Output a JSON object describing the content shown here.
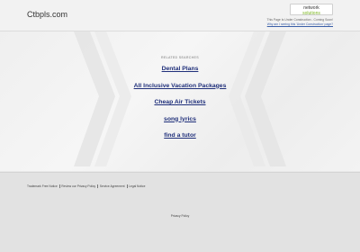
{
  "header": {
    "domain": "Ctbpls.com",
    "logo_line1": "network",
    "logo_line2": "solutions",
    "notice_line": "This Page Is Under Construction - Coming Soon!",
    "notice_link": "Why am I seeing this 'Under Construction' page?"
  },
  "main": {
    "related_label": "RELATED SEARCHES",
    "searches": [
      "Dental Plans",
      "All Inclusive Vacation Packages",
      "Cheap Air Tickets",
      "song lyrics",
      "find a tutor"
    ]
  },
  "footer": {
    "links": [
      "Trademark Free Notice",
      "Review our Privacy Policy",
      "Service Agreement",
      "Legal Notice"
    ],
    "privacy": "Privacy Policy"
  }
}
